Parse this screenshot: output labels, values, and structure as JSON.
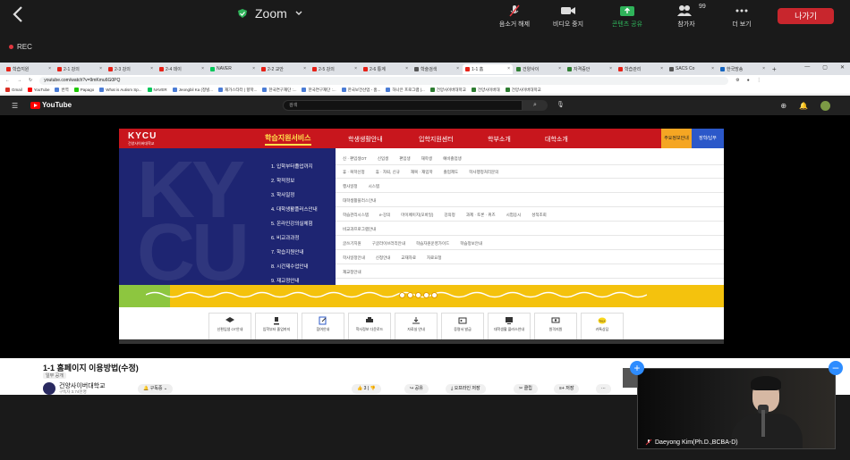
{
  "zoom": {
    "title": "Zoom",
    "controls": [
      {
        "label": "음소거 해제",
        "icon": "mic-muted-icon"
      },
      {
        "label": "비디오 중지",
        "icon": "video-icon"
      },
      {
        "label": "콘텐츠 공유",
        "icon": "share-screen-icon"
      },
      {
        "label": "참가자",
        "icon": "participants-icon",
        "badge": "99"
      },
      {
        "label": "더 보기",
        "icon": "more-icon"
      }
    ],
    "leave_label": "나가기",
    "rec_label": "REC",
    "colors": {
      "leave": "#c8262d",
      "share": "#2fb35a",
      "accent": "#2d8cff"
    }
  },
  "browser": {
    "tabs": [
      "학습지원",
      "2-1 강의",
      "2-3 강의",
      "2-4 데이",
      "NAVER",
      "2-2 교안",
      "2-5 강의",
      "2-6 통계",
      "학술검색",
      "1-1 홈",
      "건양사이",
      "자격증안",
      "학습관리",
      "SACS Co",
      "한국방송"
    ],
    "url": "youtube.com/watch?v=9mKmu6G0PQ",
    "bookmarks": [
      "Gmail",
      "YouTube",
      "번역",
      "Papago",
      "What is Autism Sp...",
      "NAVER",
      "Jeongbil Ka (정빌...",
      "재가스타터 | 향학...",
      "한국연구재단 :...",
      "한국연구재단 :...",
      "한국보건산업 - 홈...",
      "하나은 프로그램 |...",
      "건양사이버대학교",
      "건양사이버대",
      "건양사이버대학교"
    ]
  },
  "youtube": {
    "search_placeholder": "검색",
    "video_title": "1-1 홈페이지 이용방법(수정)",
    "tag": "일부 공개",
    "channel_name": "건양사이버대학교",
    "channel_subs": "구독자 3.74천명",
    "subscribe_label": "구독중",
    "like_count": "3",
    "share_label": "공유",
    "download_label": "오프라인 저장",
    "clip_label": "클립",
    "save_label": "저장"
  },
  "site": {
    "logo": "KYCU",
    "logo_sub": "건양사이버대학교",
    "nav": [
      "학습지원서비스",
      "학생생활안내",
      "입학지원센터",
      "학부소개",
      "대학소개"
    ],
    "btn1": "주요정보안내",
    "btn2": "장학/납부",
    "menu": [
      "1. 입학부터졸업까지",
      "2. 학적정보",
      "3. 학사일정",
      "4. 대학생활플러스안내",
      "5. 온라인강의실체험",
      "6. 비교과과정",
      "7. 학습지원안내",
      "8. 시간제수업안내",
      "9. 재교정안내"
    ],
    "rows": [
      [
        "신 · 편입생OT",
        "신입생",
        "편입생",
        "재학생",
        "예비졸업생"
      ],
      [
        "휴 · 복학신청",
        "휴 · 자퇴, 신규",
        "재복 · 재입학",
        "졸업제도",
        "학사행정처리문의"
      ],
      [
        "행사일정",
        "시스템"
      ],
      [
        "대학생활플러스안내"
      ],
      [
        "학습관리시스템",
        "e-강의",
        "마이페이지(모바일)",
        "강의정",
        "과제 · 토론 · 퀴즈",
        "시험응시",
        "성적조회"
      ],
      [
        "비교과프로그램안내"
      ],
      [
        "글쓰기지원",
        "구글라이브러리안내",
        "학습자원운영가이드",
        "학습정보안내"
      ],
      [
        "학사일정안내",
        "신청안내",
        "교재자료",
        "자료요청"
      ],
      [
        "재교정안내"
      ]
    ],
    "icons": [
      "신편입생 OT안내",
      "입학부터 졸업까지",
      "참여안내",
      "학사정보 다운로드",
      "자료실 안내",
      "증명서 발급",
      "대학생활 플러스안내",
      "원격지원",
      "카톡상담"
    ]
  },
  "selfview": {
    "name": "Daeyong Kim(Ph.D.,BCBA-D)"
  }
}
